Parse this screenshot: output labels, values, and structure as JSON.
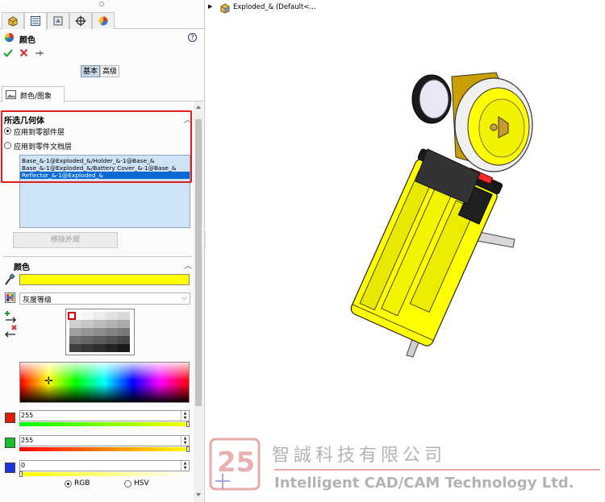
{
  "panel": {
    "title": "颜色",
    "help": "?",
    "mode_buttons": [
      "基本",
      "高级"
    ],
    "subtab": "颜色/图象"
  },
  "geometry": {
    "title": "所选几何体",
    "options": [
      "应用到零部件层",
      "应用到零件文档层"
    ],
    "selected_option": 0,
    "items": [
      "Base_&-1@Exploded_&/Holder_&-1@Base_&",
      "Base_&-1@Exploded_&/Battery Cover_&-1@Base_&",
      "Reflector_&-1@Exploded_&"
    ],
    "selected_item": 2,
    "remove_button": "移除外观"
  },
  "color": {
    "title": "颜色",
    "current": "#ffff00",
    "palette": "灰度等级",
    "channels": [
      {
        "swatch": "#e11d00",
        "value": "255",
        "fraction": 1.0
      },
      {
        "swatch": "#19c02a",
        "value": "255",
        "fraction": 1.0
      },
      {
        "swatch": "#1a36e0",
        "value": "0",
        "fraction": 0.0
      }
    ],
    "models": [
      "RGB",
      "HSV"
    ],
    "selected_model": 0
  },
  "graphics": {
    "tree_text": "Exploded_&  (Default<..."
  },
  "watermark": {
    "company_cn": "智誠科技有限公司",
    "company_en": "Intelligent CAD/CAM Technology Ltd."
  }
}
